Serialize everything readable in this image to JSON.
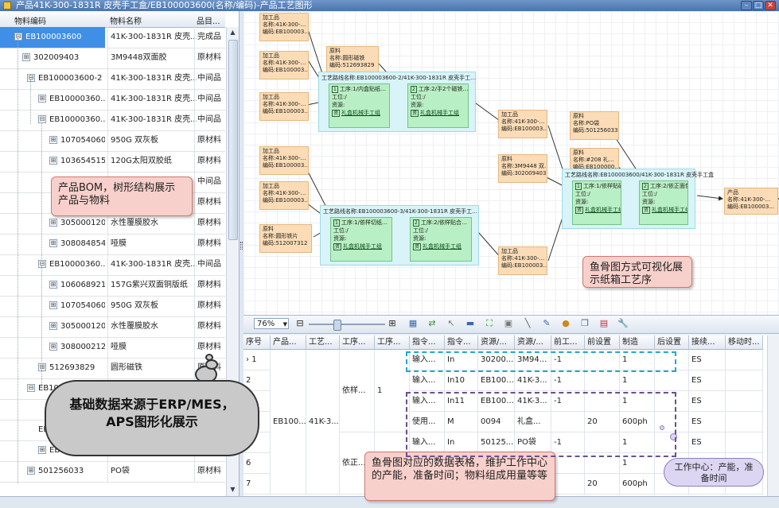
{
  "window": {
    "title": "产品41K-300-1831R 皮壳手工盒/EB100003600(名称/编码)-产品工艺图形"
  },
  "tree": {
    "columns": [
      "物料编码",
      "物料名称",
      "品目..."
    ],
    "rows": [
      {
        "code": "EB100003600",
        "name": "41K-300-1831R 皮壳...",
        "type": "完成品",
        "expander": "⊟",
        "indicator": "›"
      },
      {
        "code": "302009403",
        "name": "3M9448双面胶",
        "type": "原材料",
        "expander": "⊞"
      },
      {
        "code": "EB100003600-2",
        "name": "41K-300-1831R 皮壳...",
        "type": "中间品",
        "expander": "⊟"
      },
      {
        "code": "EB10000360...",
        "name": "41K-300-1831R 皮壳...",
        "type": "中间品",
        "expander": "⊞"
      },
      {
        "code": "EB10000360...",
        "name": "41K-300-1831R 皮壳...",
        "type": "中间品",
        "expander": "⊟"
      },
      {
        "code": "107054060",
        "name": "950G 双灰板",
        "type": "原材料",
        "expander": "⊞"
      },
      {
        "code": "103654515",
        "name": "120G太阳双胶纸",
        "type": "原材料",
        "expander": "⊞"
      },
      {
        "code": "",
        "name": "",
        "type": "中间品",
        "expander": ""
      },
      {
        "code": "",
        "name": "",
        "type": "原材料",
        "expander": ""
      },
      {
        "code": "305000120",
        "name": "水性覆膜胶水",
        "type": "原材料",
        "expander": "⊞"
      },
      {
        "code": "308084854",
        "name": "哑膜",
        "type": "原材料",
        "expander": "⊞"
      },
      {
        "code": "EB10000360...",
        "name": "41K-300-1831R 皮壳...",
        "type": "中间品",
        "expander": "⊟"
      },
      {
        "code": "106068921",
        "name": "157G紫兴双面铜版纸",
        "type": "原材料",
        "expander": "⊞"
      },
      {
        "code": "107054060",
        "name": "950G 双灰板",
        "type": "原材料",
        "expander": "⊞"
      },
      {
        "code": "305000120",
        "name": "水性覆膜胶水",
        "type": "原材料",
        "expander": "⊞"
      },
      {
        "code": "308000212",
        "name": "哑膜",
        "type": "原材料",
        "expander": "⊞"
      },
      {
        "code": "512693829",
        "name": "圆形磁铁",
        "type": "原材料",
        "expander": "⊞"
      },
      {
        "code": "EB10000",
        "name": "",
        "type": "",
        "expander": "⊟"
      },
      {
        "code": "",
        "name": "",
        "type": "",
        "expander": ""
      },
      {
        "code": "EE",
        "name": "",
        "type": "",
        "expander": ""
      },
      {
        "code": "EB10000360...",
        "name": "41K-300-1831R 皮壳...",
        "type": "中间品",
        "expander": "⊞"
      },
      {
        "code": "501256033",
        "name": "PO袋",
        "type": "原材料",
        "expander": "⊞"
      }
    ]
  },
  "diagram": {
    "inputs": [
      {
        "l1": "加工品",
        "l2": "名称:41K-300-…",
        "l3": "编码:EB100003…"
      },
      {
        "l1": "加工品",
        "l2": "名称:41K-300-…",
        "l3": "编码:EB100003…"
      },
      {
        "l1": "原料",
        "l2": "名称:圆形磁铁",
        "l3": "编码:512693829"
      },
      {
        "l1": "加工品",
        "l2": "名称:41K-300-…",
        "l3": "编码:EB100003…"
      },
      {
        "l1": "加工品",
        "l2": "名称:41K-300-…",
        "l3": "编码:EB100003…"
      },
      {
        "l1": "加工品",
        "l2": "名称:41K-300-…",
        "l3": "编码:EB100003…"
      },
      {
        "l1": "原料",
        "l2": "名称:圆形铁片",
        "l3": "编码:512007312"
      },
      {
        "l1": "加工品",
        "l2": "名称:41K-300-…",
        "l3": "编码:EB100003…"
      },
      {
        "l1": "原料",
        "l2": "名称:3M9448 双…",
        "l3": "编码:302009403"
      },
      {
        "l1": "加工品",
        "l2": "名称:41K-300-…",
        "l3": "编码:EB100003…"
      },
      {
        "l1": "原料",
        "l2": "名称:PO袋",
        "l3": "编码:501256033"
      },
      {
        "l1": "原料",
        "l2": "名称:#208 礼…",
        "l3": "编码:EB100000…"
      },
      {
        "l1": "产品",
        "l2": "名称:41K-300-…",
        "l3": "编码:EB100003…"
      }
    ],
    "processes": [
      {
        "title": "工艺路线名称:EB100003600-2/41K-300-1831R 皮壳手工…",
        "steps": [
          {
            "op": "工序:1/内盒贴纸…",
            "wc": "工位:/",
            "res": "资源:",
            "rsn": "礼盒机械手工组"
          },
          {
            "op": "工序:2/手2个磁铁…",
            "wc": "工位:/",
            "res": "资源:",
            "rsn": "礼盒机械手工组"
          }
        ]
      },
      {
        "title": "工艺路线名称:EB100003600-3/41K-300-1831R 皮壳手工…",
        "steps": [
          {
            "op": "工序:1/依样切纸…",
            "wc": "工位:/",
            "res": "资源:",
            "rsn": "礼盒机械手工组"
          },
          {
            "op": "工序:2/依样贴合…",
            "wc": "工位:/",
            "res": "资源:",
            "rsn": "礼盒机械手工组"
          }
        ]
      },
      {
        "title": "工艺路线名称:EB100003600/41K-300-1831R 皮壳手工盒",
        "steps": [
          {
            "op": "工序:1/依样贴磁…",
            "wc": "工位:/",
            "res": "资源:",
            "rsn": "礼盒机械手工组"
          },
          {
            "op": "工序:2/依正面包…",
            "wc": "工位:/",
            "res": "资源:",
            "rsn": "礼盒机械手工组"
          }
        ]
      }
    ],
    "step_no": [
      "1",
      "2"
    ]
  },
  "toolbar": {
    "zoom": "76%"
  },
  "grid": {
    "columns": [
      "序号",
      "产品...",
      "工艺...",
      "工序...",
      "工序...",
      "指令...",
      "指令...",
      "资源/...",
      "资源/...",
      "前工...",
      "前设置",
      "制造",
      "后设置",
      "接续...",
      "移动时..."
    ],
    "rows": [
      {
        "no": "1",
        "p": "",
        "r": "",
        "o1": "",
        "o2": "",
        "t1": "输入...",
        "t2": "In",
        "r1": "30200...",
        "r2": "3M94...",
        "pre": "-1",
        "ps": "",
        "mf": "1",
        "as": "",
        "cn": "ES",
        "mv": "",
        "ind": "›"
      },
      {
        "no": "2",
        "p": "",
        "r": "",
        "o1": "",
        "o2": "",
        "t1": "输入...",
        "t2": "In10",
        "r1": "EB100...",
        "r2": "41K-3...",
        "pre": "-1",
        "ps": "",
        "mf": "1",
        "as": "",
        "cn": "ES",
        "mv": ""
      },
      {
        "no": "",
        "p": "",
        "r": "",
        "o1": "",
        "o2": "",
        "t1": "输入...",
        "t2": "In11",
        "r1": "EB100...",
        "r2": "41K-3...",
        "pre": "-1",
        "ps": "",
        "mf": "1",
        "as": "",
        "cn": "ES",
        "mv": ""
      },
      {
        "no": "",
        "p": "",
        "r": "",
        "o1": "",
        "o2": "",
        "t1": "使用...",
        "t2": "M",
        "r1": "0094",
        "r2": "礼盒...",
        "pre": "",
        "ps": "20",
        "mf": "600ph",
        "as": "",
        "cn": "ES",
        "mv": ""
      },
      {
        "no": "5",
        "p": "",
        "r": "",
        "o1": "",
        "o2": "",
        "t1": "输入...",
        "t2": "In",
        "r1": "50125...",
        "r2": "PO袋",
        "pre": "-1",
        "ps": "",
        "mf": "1",
        "as": "",
        "cn": "ES",
        "mv": ""
      },
      {
        "no": "6",
        "p": "",
        "r": "",
        "o1": "",
        "o2": "",
        "t1": "",
        "t2": "",
        "r1": "",
        "r2": "",
        "pre": "",
        "ps": "",
        "mf": "1",
        "as": "",
        "cn": "",
        "mv": ""
      },
      {
        "no": "7",
        "p": "",
        "r": "",
        "o1": "",
        "o2": "",
        "t1": "",
        "t2": "",
        "r1": "",
        "r2": "",
        "pre": "",
        "ps": "20",
        "mf": "600ph",
        "as": "",
        "cn": "",
        "mv": ""
      }
    ],
    "merged": {
      "product": "EB100...",
      "route": "41K-3...",
      "op_a": "依样...",
      "op_a2": "1",
      "op_b": "依正..."
    }
  },
  "annotations": {
    "bom": "产品BOM，树形结构展示产品与物料",
    "fishbone": "鱼骨图方式可视化展示纸箱工艺序",
    "erp": "基础数据来源于ERP/MES，APS图形化展示",
    "table": "鱼骨图对应的数据表格，维护工作中心的产能，准备时间；物料组成用量等等",
    "wc": "工作中心：产能，准备时间"
  },
  "colors": {
    "material_node": "#fbdcb6",
    "process_box": "#d8f4f8",
    "step_box": "#b9efc4",
    "callout": "#f7d0cc",
    "selection": "#3f8ee8"
  }
}
